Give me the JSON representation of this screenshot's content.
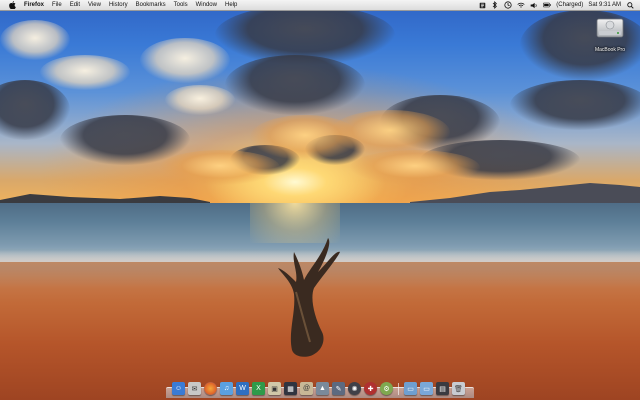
{
  "menubar": {
    "app_name": "Firefox",
    "items": [
      "File",
      "Edit",
      "View",
      "History",
      "Bookmarks",
      "Tools",
      "Window",
      "Help"
    ],
    "battery_text": "(Charged)",
    "clock": "Sat 9:31 AM"
  },
  "desktop": {
    "hd_label": "MacBook Pro"
  },
  "icons": {
    "apple": "apple-icon",
    "script": "script-menu-icon",
    "bluetooth": "bluetooth-icon",
    "timemachine": "time-machine-icon",
    "wifi": "wifi-icon",
    "volume": "volume-icon",
    "battery": "battery-icon",
    "spotlight": "spotlight-icon",
    "hd": "hard-drive-icon"
  },
  "dock": {
    "apps": [
      {
        "name": "finder-icon",
        "color": "#3a7bd5"
      },
      {
        "name": "mail-stamp-icon",
        "color": "#c8c8c8"
      },
      {
        "name": "firefox-icon",
        "color": "#e8762b"
      },
      {
        "name": "itunes-icon",
        "color": "#5aa0e0"
      },
      {
        "name": "word-icon",
        "color": "#2f6fc0"
      },
      {
        "name": "excel-icon",
        "color": "#2f9a4a"
      },
      {
        "name": "preview-icon",
        "color": "#d0c8a8"
      },
      {
        "name": "dashboard-icon",
        "color": "#303440"
      },
      {
        "name": "address-book-icon",
        "color": "#c8b896"
      },
      {
        "name": "photo-icon",
        "color": "#7a8a9a"
      },
      {
        "name": "pen-tool-icon",
        "color": "#5d6a80"
      },
      {
        "name": "aperture-icon",
        "color": "#404048"
      },
      {
        "name": "shield-icon",
        "color": "#b03030"
      },
      {
        "name": "system-prefs-icon",
        "color": "#7fa850"
      }
    ],
    "folders": [
      {
        "name": "applications-folder-icon",
        "color": "#6f9fd0"
      },
      {
        "name": "documents-folder-icon",
        "color": "#7aa8d8"
      },
      {
        "name": "downloads-stack-icon",
        "color": "#3a3a40"
      },
      {
        "name": "trash-icon",
        "color": "#c8ccd2"
      }
    ]
  }
}
